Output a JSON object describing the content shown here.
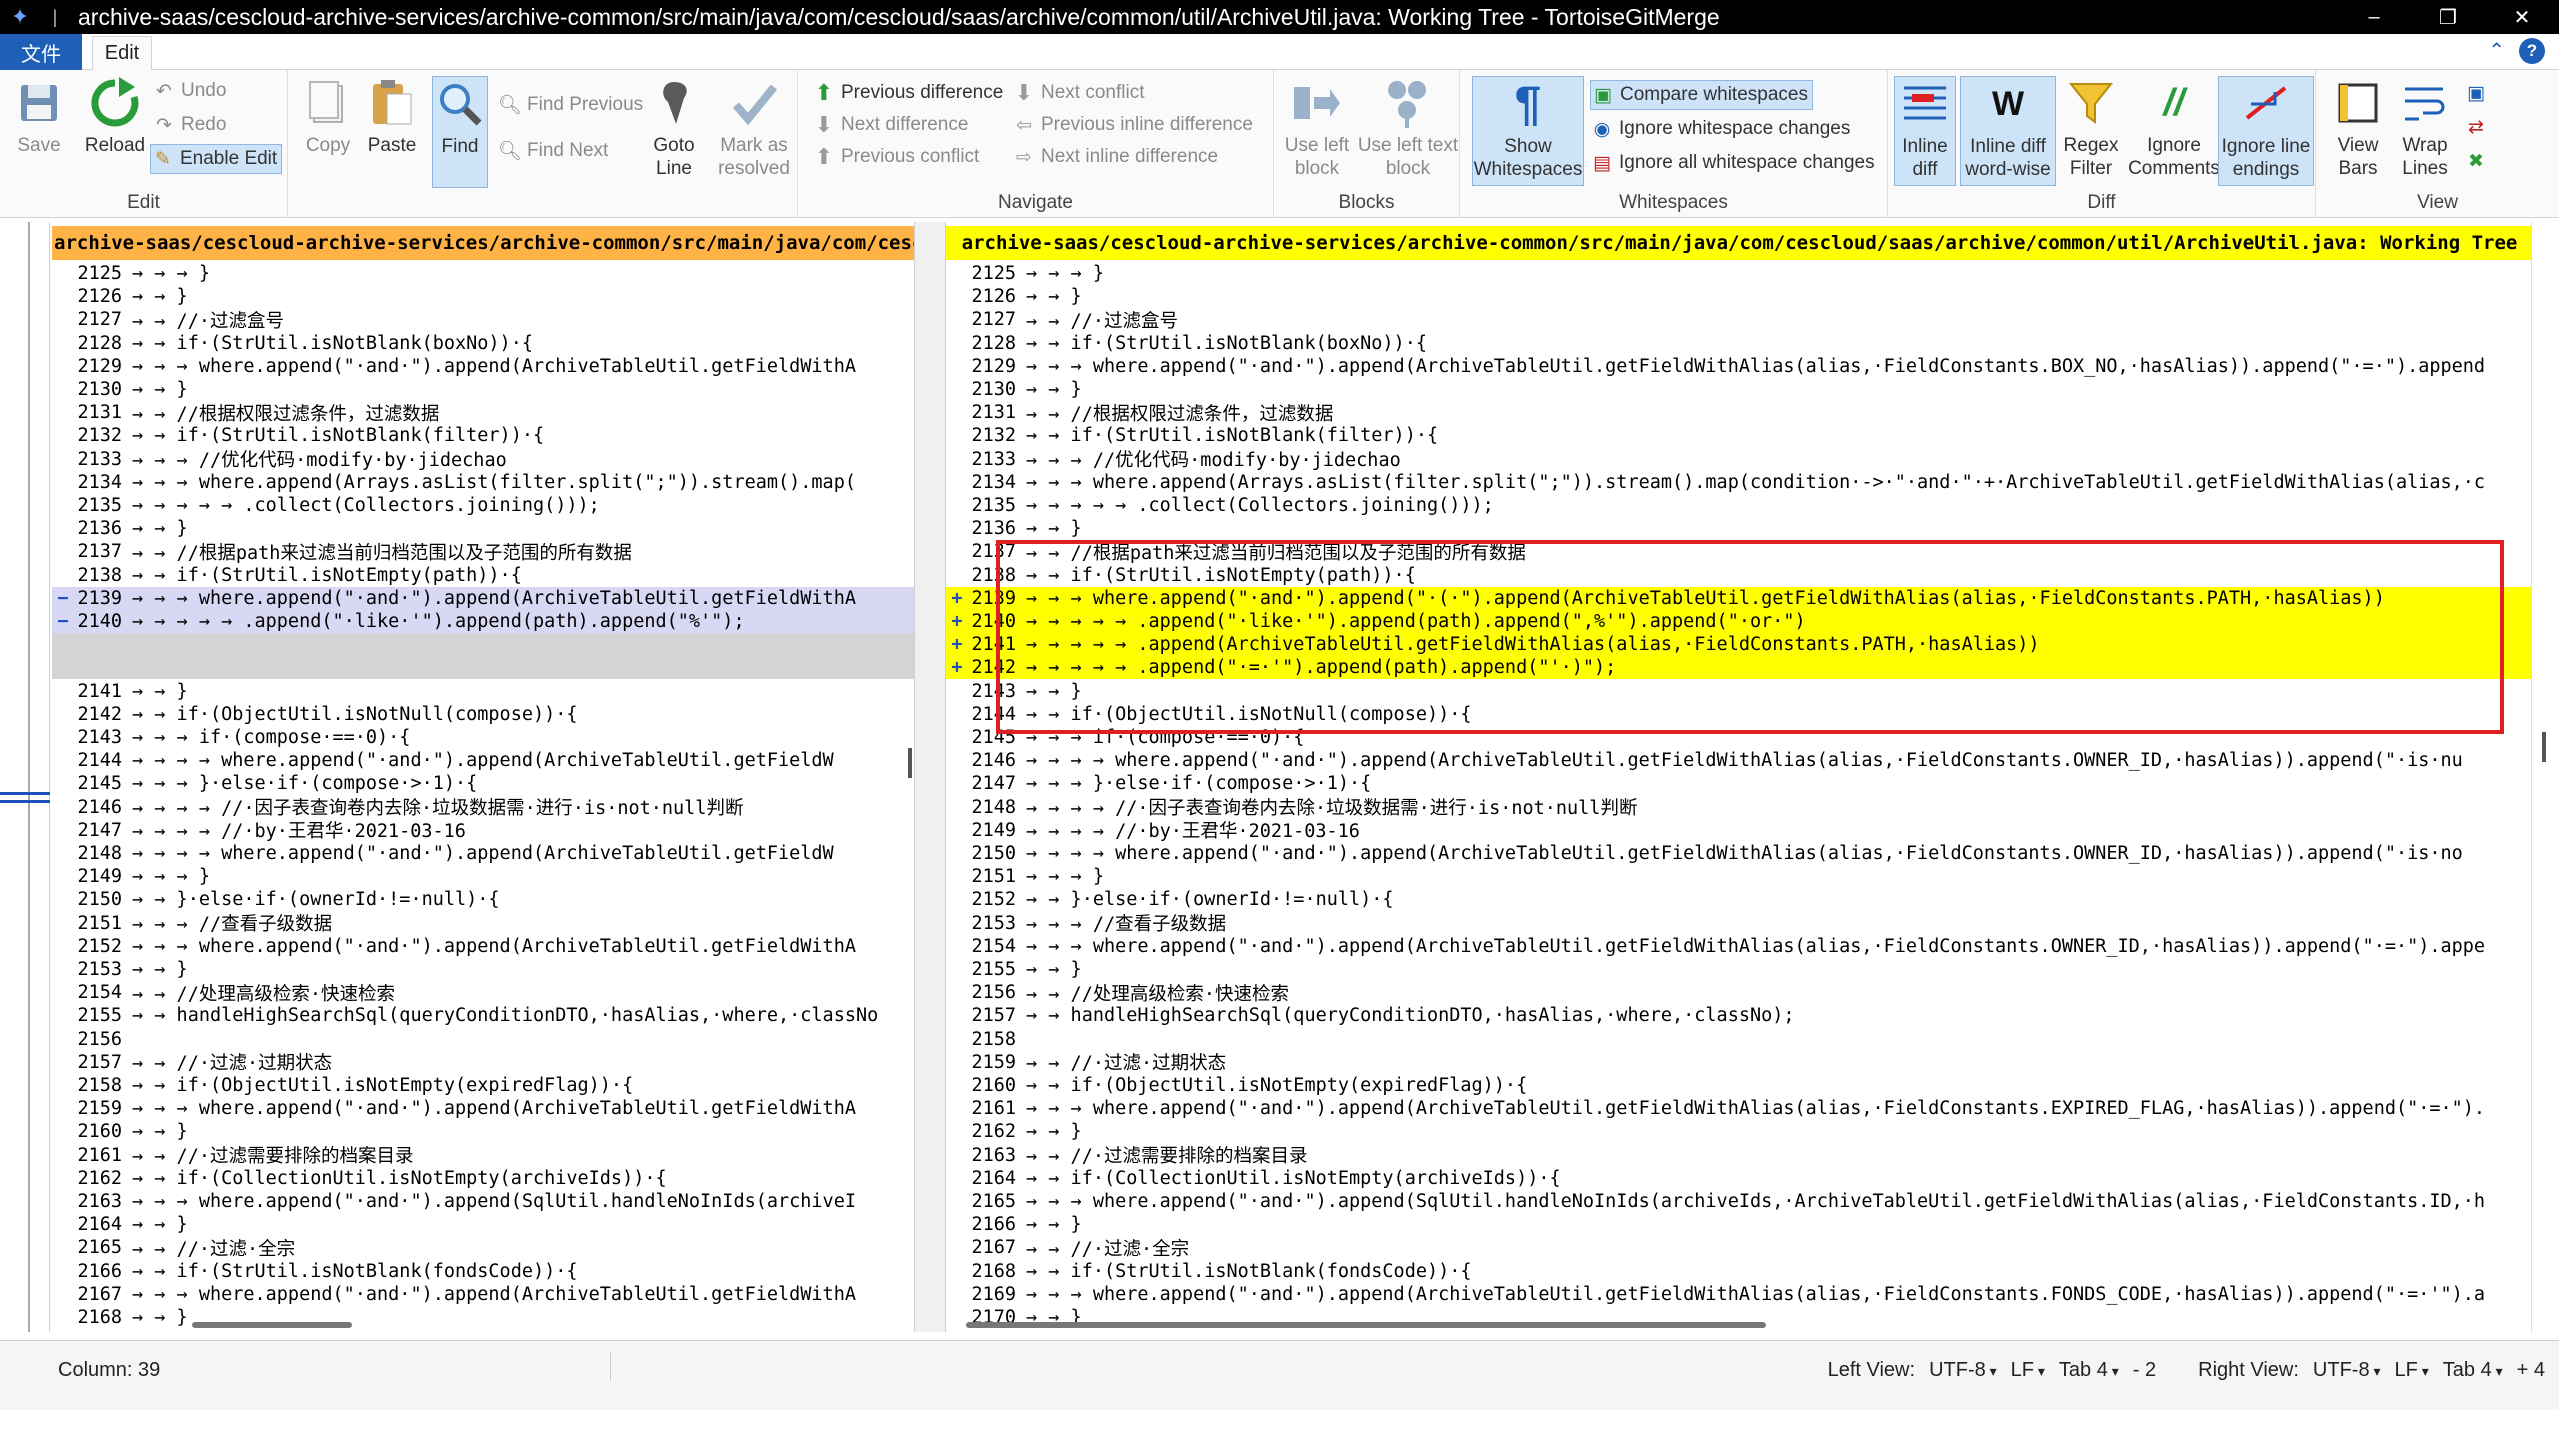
{
  "window": {
    "title": "archive-saas/cescloud-archive-services/archive-common/src/main/java/com/cescloud/saas/archive/common/util/ArchiveUtil.java: Working Tree - TortoiseGitMerge",
    "minimize": "–",
    "restore": "❐",
    "close": "✕"
  },
  "menu": {
    "file": "文件",
    "edit": "Edit"
  },
  "ribbon": {
    "save": "Save",
    "reload": "Reload",
    "undo": "Undo",
    "redo": "Redo",
    "enable_edit": "Enable Edit",
    "edit_group": "Edit",
    "copy": "Copy",
    "paste": "Paste",
    "find": "Find",
    "find_previous": "Find Previous",
    "find_next": "Find Next",
    "goto_line_1": "Goto",
    "goto_line_2": "Line",
    "mark_resolved_1": "Mark as",
    "mark_resolved_2": "resolved",
    "previous_difference": "Previous difference",
    "next_difference": "Next difference",
    "previous_conflict": "Previous conflict",
    "next_conflict": "Next conflict",
    "previous_inline_difference": "Previous inline difference",
    "next_inline_difference": "Next inline difference",
    "navigate_group": "Navigate",
    "use_left_block_1": "Use left",
    "use_left_block_2": "block",
    "use_left_text_1": "Use left text",
    "use_left_text_2": "block",
    "blocks_group": "Blocks",
    "show_ws_1": "Show",
    "show_ws_2": "Whitespaces",
    "compare_whitespaces": "Compare whitespaces",
    "ignore_ws_changes": "Ignore whitespace changes",
    "ignore_all_ws_changes": "Ignore all whitespace changes",
    "whitespaces_group": "Whitespaces",
    "inline_diff_1": "Inline",
    "inline_diff_2": "diff",
    "inline_diff_word_1": "Inline diff",
    "inline_diff_word_2": "word-wise",
    "regex_filter_1": "Regex",
    "regex_filter_2": "Filter",
    "ignore_comments_1": "Ignore",
    "ignore_comments_2": "Comments",
    "ignore_line_endings_1": "Ignore line",
    "ignore_line_endings_2": "endings",
    "diff_group": "Diff",
    "view_bars_1": "View",
    "view_bars_2": "Bars",
    "wrap_lines_1": "Wrap",
    "wrap_lines_2": "Lines",
    "view_group": "View"
  },
  "left_pane": {
    "header": "archive-saas/cescloud-archive-services/archive-common/src/main/java/com/cescloud",
    "lines": [
      {
        "n": "2125",
        "m": "",
        "t": "",
        "c": "→ → → }"
      },
      {
        "n": "2126",
        "m": "",
        "t": "",
        "c": "→ → }"
      },
      {
        "n": "2127",
        "m": "",
        "t": "",
        "c": "→ → //·过滤盒号"
      },
      {
        "n": "2128",
        "m": "",
        "t": "",
        "c": "→ → if·(StrUtil.isNotBlank(boxNo))·{"
      },
      {
        "n": "2129",
        "m": "",
        "t": "",
        "c": "→ → → where.append(\"·and·\").append(ArchiveTableUtil.getFieldWithA"
      },
      {
        "n": "2130",
        "m": "",
        "t": "",
        "c": "→ → }"
      },
      {
        "n": "2131",
        "m": "",
        "t": "",
        "c": "→ → //根据权限过滤条件，过滤数据"
      },
      {
        "n": "2132",
        "m": "",
        "t": "",
        "c": "→ → if·(StrUtil.isNotBlank(filter))·{"
      },
      {
        "n": "2133",
        "m": "",
        "t": "",
        "c": "→ → → //优化代码·modify·by·jidechao"
      },
      {
        "n": "2134",
        "m": "",
        "t": "",
        "c": "→ → → where.append(Arrays.asList(filter.split(\";\")).stream().map("
      },
      {
        "n": "2135",
        "m": "",
        "t": "",
        "c": "→ → → → → .collect(Collectors.joining()));"
      },
      {
        "n": "2136",
        "m": "",
        "t": "",
        "c": "→ → }"
      },
      {
        "n": "2137",
        "m": "",
        "t": "",
        "c": "→ → //根据path来过滤当前归档范围以及子范围的所有数据"
      },
      {
        "n": "2138",
        "m": "",
        "t": "",
        "c": "→ → if·(StrUtil.isNotEmpty(path))·{"
      },
      {
        "n": "2139",
        "m": "−",
        "t": "removed",
        "c": "→ → → where.append(\"·and·\").append(ArchiveTableUtil.getFieldWithA"
      },
      {
        "n": "2140",
        "m": "−",
        "t": "removed",
        "c": "→ → → → → .append(\"·like·'\").append(path).append(\"%'\");"
      },
      {
        "n": "",
        "m": "",
        "t": "gap",
        "c": ""
      },
      {
        "n": "",
        "m": "",
        "t": "gap",
        "c": ""
      },
      {
        "n": "2141",
        "m": "",
        "t": "",
        "c": "→ → }"
      },
      {
        "n": "2142",
        "m": "",
        "t": "",
        "c": "→ → if·(ObjectUtil.isNotNull(compose))·{"
      },
      {
        "n": "2143",
        "m": "",
        "t": "",
        "c": "→ → → if·(compose·==·0)·{"
      },
      {
        "n": "2144",
        "m": "",
        "t": "",
        "c": "→ → → → where.append(\"·and·\").append(ArchiveTableUtil.getFieldW"
      },
      {
        "n": "2145",
        "m": "",
        "t": "",
        "c": "→ → → }·else·if·(compose·>·1)·{"
      },
      {
        "n": "2146",
        "m": "",
        "t": "",
        "c": "→ → → → //·因子表查询卷内去除·垃圾数据需·进行·is·not·null判断"
      },
      {
        "n": "2147",
        "m": "",
        "t": "",
        "c": "→ → → → //·by·王君华·2021-03-16"
      },
      {
        "n": "2148",
        "m": "",
        "t": "",
        "c": "→ → → → where.append(\"·and·\").append(ArchiveTableUtil.getFieldW"
      },
      {
        "n": "2149",
        "m": "",
        "t": "",
        "c": "→ → → }"
      },
      {
        "n": "2150",
        "m": "",
        "t": "",
        "c": "→ → }·else·if·(ownerId·!=·null)·{"
      },
      {
        "n": "2151",
        "m": "",
        "t": "",
        "c": "→ → → //查看子级数据"
      },
      {
        "n": "2152",
        "m": "",
        "t": "",
        "c": "→ → → where.append(\"·and·\").append(ArchiveTableUtil.getFieldWithA"
      },
      {
        "n": "2153",
        "m": "",
        "t": "",
        "c": "→ → }"
      },
      {
        "n": "2154",
        "m": "",
        "t": "",
        "c": "→ → //处理高级检索·快速检索"
      },
      {
        "n": "2155",
        "m": "",
        "t": "",
        "c": "→ → handleHighSearchSql(queryConditionDTO,·hasAlias,·where,·classNo"
      },
      {
        "n": "2156",
        "m": "",
        "t": "",
        "c": ""
      },
      {
        "n": "2157",
        "m": "",
        "t": "",
        "c": "→ → //·过滤·过期状态"
      },
      {
        "n": "2158",
        "m": "",
        "t": "",
        "c": "→ → if·(ObjectUtil.isNotEmpty(expiredFlag))·{"
      },
      {
        "n": "2159",
        "m": "",
        "t": "",
        "c": "→ → → where.append(\"·and·\").append(ArchiveTableUtil.getFieldWithA"
      },
      {
        "n": "2160",
        "m": "",
        "t": "",
        "c": "→ → }"
      },
      {
        "n": "2161",
        "m": "",
        "t": "",
        "c": "→ → //·过滤需要排除的档案目录"
      },
      {
        "n": "2162",
        "m": "",
        "t": "",
        "c": "→ → if·(CollectionUtil.isNotEmpty(archiveIds))·{"
      },
      {
        "n": "2163",
        "m": "",
        "t": "",
        "c": "→ → → where.append(\"·and·\").append(SqlUtil.handleNoInIds(archiveI"
      },
      {
        "n": "2164",
        "m": "",
        "t": "",
        "c": "→ → }"
      },
      {
        "n": "2165",
        "m": "",
        "t": "",
        "c": "→ → //·过滤·全宗"
      },
      {
        "n": "2166",
        "m": "",
        "t": "",
        "c": "→ → if·(StrUtil.isNotBlank(fondsCode))·{"
      },
      {
        "n": "2167",
        "m": "",
        "t": "",
        "c": "→ → → where.append(\"·and·\").append(ArchiveTableUtil.getFieldWithA"
      },
      {
        "n": "2168",
        "m": "",
        "t": "",
        "c": "→ → }"
      }
    ]
  },
  "right_pane": {
    "header": "archive-saas/cescloud-archive-services/archive-common/src/main/java/com/cescloud/saas/archive/common/util/ArchiveUtil.java: Working Tree",
    "lines": [
      {
        "n": "2125",
        "m": "",
        "t": "",
        "c": "→ → → }"
      },
      {
        "n": "2126",
        "m": "",
        "t": "",
        "c": "→ → }"
      },
      {
        "n": "2127",
        "m": "",
        "t": "",
        "c": "→ → //·过滤盒号"
      },
      {
        "n": "2128",
        "m": "",
        "t": "",
        "c": "→ → if·(StrUtil.isNotBlank(boxNo))·{"
      },
      {
        "n": "2129",
        "m": "",
        "t": "",
        "c": "→ → → where.append(\"·and·\").append(ArchiveTableUtil.getFieldWithAlias(alias,·FieldConstants.BOX_NO,·hasAlias)).append(\"·=·\").append"
      },
      {
        "n": "2130",
        "m": "",
        "t": "",
        "c": "→ → }"
      },
      {
        "n": "2131",
        "m": "",
        "t": "",
        "c": "→ → //根据权限过滤条件，过滤数据"
      },
      {
        "n": "2132",
        "m": "",
        "t": "",
        "c": "→ → if·(StrUtil.isNotBlank(filter))·{"
      },
      {
        "n": "2133",
        "m": "",
        "t": "",
        "c": "→ → → //优化代码·modify·by·jidechao"
      },
      {
        "n": "2134",
        "m": "",
        "t": "",
        "c": "→ → → where.append(Arrays.asList(filter.split(\";\")).stream().map(condition·->·\"·and·\"·+·ArchiveTableUtil.getFieldWithAlias(alias,·c"
      },
      {
        "n": "2135",
        "m": "",
        "t": "",
        "c": "→ → → → → .collect(Collectors.joining()));"
      },
      {
        "n": "2136",
        "m": "",
        "t": "",
        "c": "→ → }"
      },
      {
        "n": "2137",
        "m": "",
        "t": "",
        "c": "→ → //根据path来过滤当前归档范围以及子范围的所有数据"
      },
      {
        "n": "2138",
        "m": "",
        "t": "",
        "c": "→ → if·(StrUtil.isNotEmpty(path))·{"
      },
      {
        "n": "2139",
        "m": "+",
        "t": "added",
        "c": "→ → → where.append(\"·and·\").append(\"·(·\").append(ArchiveTableUtil.getFieldWithAlias(alias,·FieldConstants.PATH,·hasAlias))"
      },
      {
        "n": "2140",
        "m": "+",
        "t": "added",
        "c": "→ → → → → .append(\"·like·'\").append(path).append(\",%'\").append(\"·or·\")"
      },
      {
        "n": "2141",
        "m": "+",
        "t": "added",
        "c": "→ → → → → .append(ArchiveTableUtil.getFieldWithAlias(alias,·FieldConstants.PATH,·hasAlias))"
      },
      {
        "n": "2142",
        "m": "+",
        "t": "added",
        "c": "→ → → → → .append(\"·=·'\").append(path).append(\"'·)\");"
      },
      {
        "n": "2143",
        "m": "",
        "t": "",
        "c": "→ → }"
      },
      {
        "n": "2144",
        "m": "",
        "t": "",
        "c": "→ → if·(ObjectUtil.isNotNull(compose))·{"
      },
      {
        "n": "2145",
        "m": "",
        "t": "",
        "c": "→ → → if·(compose·==·0)·{"
      },
      {
        "n": "2146",
        "m": "",
        "t": "",
        "c": "→ → → → where.append(\"·and·\").append(ArchiveTableUtil.getFieldWithAlias(alias,·FieldConstants.OWNER_ID,·hasAlias)).append(\"·is·nu"
      },
      {
        "n": "2147",
        "m": "",
        "t": "",
        "c": "→ → → }·else·if·(compose·>·1)·{"
      },
      {
        "n": "2148",
        "m": "",
        "t": "",
        "c": "→ → → → //·因子表查询卷内去除·垃圾数据需·进行·is·not·null判断"
      },
      {
        "n": "2149",
        "m": "",
        "t": "",
        "c": "→ → → → //·by·王君华·2021-03-16"
      },
      {
        "n": "2150",
        "m": "",
        "t": "",
        "c": "→ → → → where.append(\"·and·\").append(ArchiveTableUtil.getFieldWithAlias(alias,·FieldConstants.OWNER_ID,·hasAlias)).append(\"·is·no"
      },
      {
        "n": "2151",
        "m": "",
        "t": "",
        "c": "→ → → }"
      },
      {
        "n": "2152",
        "m": "",
        "t": "",
        "c": "→ → }·else·if·(ownerId·!=·null)·{"
      },
      {
        "n": "2153",
        "m": "",
        "t": "",
        "c": "→ → → //查看子级数据"
      },
      {
        "n": "2154",
        "m": "",
        "t": "",
        "c": "→ → → where.append(\"·and·\").append(ArchiveTableUtil.getFieldWithAlias(alias,·FieldConstants.OWNER_ID,·hasAlias)).append(\"·=·\").appe"
      },
      {
        "n": "2155",
        "m": "",
        "t": "",
        "c": "→ → }"
      },
      {
        "n": "2156",
        "m": "",
        "t": "",
        "c": "→ → //处理高级检索·快速检索"
      },
      {
        "n": "2157",
        "m": "",
        "t": "",
        "c": "→ → handleHighSearchSql(queryConditionDTO,·hasAlias,·where,·classNo);"
      },
      {
        "n": "2158",
        "m": "",
        "t": "",
        "c": ""
      },
      {
        "n": "2159",
        "m": "",
        "t": "",
        "c": "→ → //·过滤·过期状态"
      },
      {
        "n": "2160",
        "m": "",
        "t": "",
        "c": "→ → if·(ObjectUtil.isNotEmpty(expiredFlag))·{"
      },
      {
        "n": "2161",
        "m": "",
        "t": "",
        "c": "→ → → where.append(\"·and·\").append(ArchiveTableUtil.getFieldWithAlias(alias,·FieldConstants.EXPIRED_FLAG,·hasAlias)).append(\"·=·\")."
      },
      {
        "n": "2162",
        "m": "",
        "t": "",
        "c": "→ → }"
      },
      {
        "n": "2163",
        "m": "",
        "t": "",
        "c": "→ → //·过滤需要排除的档案目录"
      },
      {
        "n": "2164",
        "m": "",
        "t": "",
        "c": "→ → if·(CollectionUtil.isNotEmpty(archiveIds))·{"
      },
      {
        "n": "2165",
        "m": "",
        "t": "",
        "c": "→ → → where.append(\"·and·\").append(SqlUtil.handleNoInIds(archiveIds,·ArchiveTableUtil.getFieldWithAlias(alias,·FieldConstants.ID,·h"
      },
      {
        "n": "2166",
        "m": "",
        "t": "",
        "c": "→ → }"
      },
      {
        "n": "2167",
        "m": "",
        "t": "",
        "c": "→ → //·过滤·全宗"
      },
      {
        "n": "2168",
        "m": "",
        "t": "",
        "c": "→ → if·(StrUtil.isNotBlank(fondsCode))·{"
      },
      {
        "n": "2169",
        "m": "",
        "t": "",
        "c": "→ → → where.append(\"·and·\").append(ArchiveTableUtil.getFieldWithAlias(alias,·FieldConstants.FONDS_CODE,·hasAlias)).append(\"·=·'\").a"
      },
      {
        "n": "2170",
        "m": "",
        "t": "",
        "c": "→ → }"
      }
    ]
  },
  "status": {
    "column": "Column: 39",
    "left_view": "Left View:",
    "left_enc": "UTF-8",
    "left_eol": "LF",
    "left_tab": "Tab 4",
    "left_count": "- 2",
    "right_view": "Right View:",
    "right_enc": "UTF-8",
    "right_eol": "LF",
    "right_tab": "Tab 4",
    "right_count": "+ 4"
  },
  "colors": {
    "added": "#ffff00",
    "removed": "#d8d8f4",
    "left_header": "#ffb347",
    "right_header": "#ffff00",
    "annotation_box": "#e02020"
  }
}
